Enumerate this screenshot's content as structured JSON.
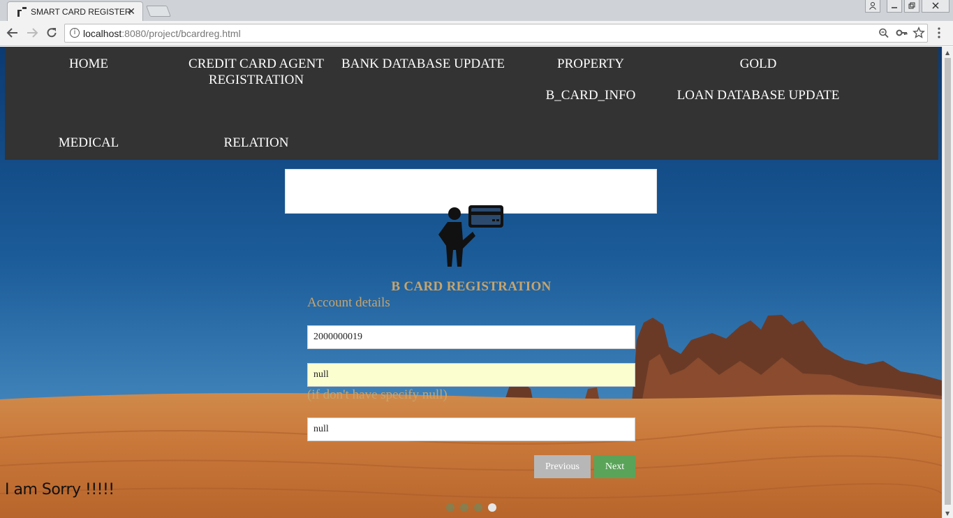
{
  "browser": {
    "tab_title": "SMART CARD REGISTER",
    "tab_close": "✕",
    "url_host": "localhost",
    "url_path": ":8080/project/bcardreg.html",
    "icons": [
      "back-arrow-icon",
      "forward-arrow-icon",
      "reload-icon",
      "info-icon",
      "zoom-icon",
      "key-icon",
      "star-icon",
      "menu-icon"
    ]
  },
  "nav": {
    "items": [
      {
        "label": "HOME"
      },
      {
        "label": "CREDIT CARD AGENT REGISTRATION"
      },
      {
        "label": "BANK DATABASE UPDATE"
      },
      {
        "label": "PROPERTY"
      },
      {
        "label": "GOLD"
      },
      {
        "label": "B_CARD_INFO"
      },
      {
        "label": "LOAN DATABASE UPDATE"
      },
      {
        "label": "MEDICAL"
      },
      {
        "label": "RELATION"
      }
    ]
  },
  "form": {
    "title": "B CARD REGISTRATION",
    "step_title": "Account details",
    "field1_value": "2000000019",
    "field2_value": "null",
    "hint": "(if don't have specify null)",
    "field3_value": "null",
    "previous_label": "Previous",
    "next_label": "Next"
  },
  "progress": {
    "steps": 4,
    "current_step": 4
  },
  "footer": {
    "sorry_text": "I am Sorry !!!!!"
  },
  "colors": {
    "nav_bg": "#333333",
    "accent_text": "#c8a46b",
    "next_button": "#5aa459",
    "previous_button": "#b7b7b7",
    "autofill_yellow": "#fbffd0"
  }
}
